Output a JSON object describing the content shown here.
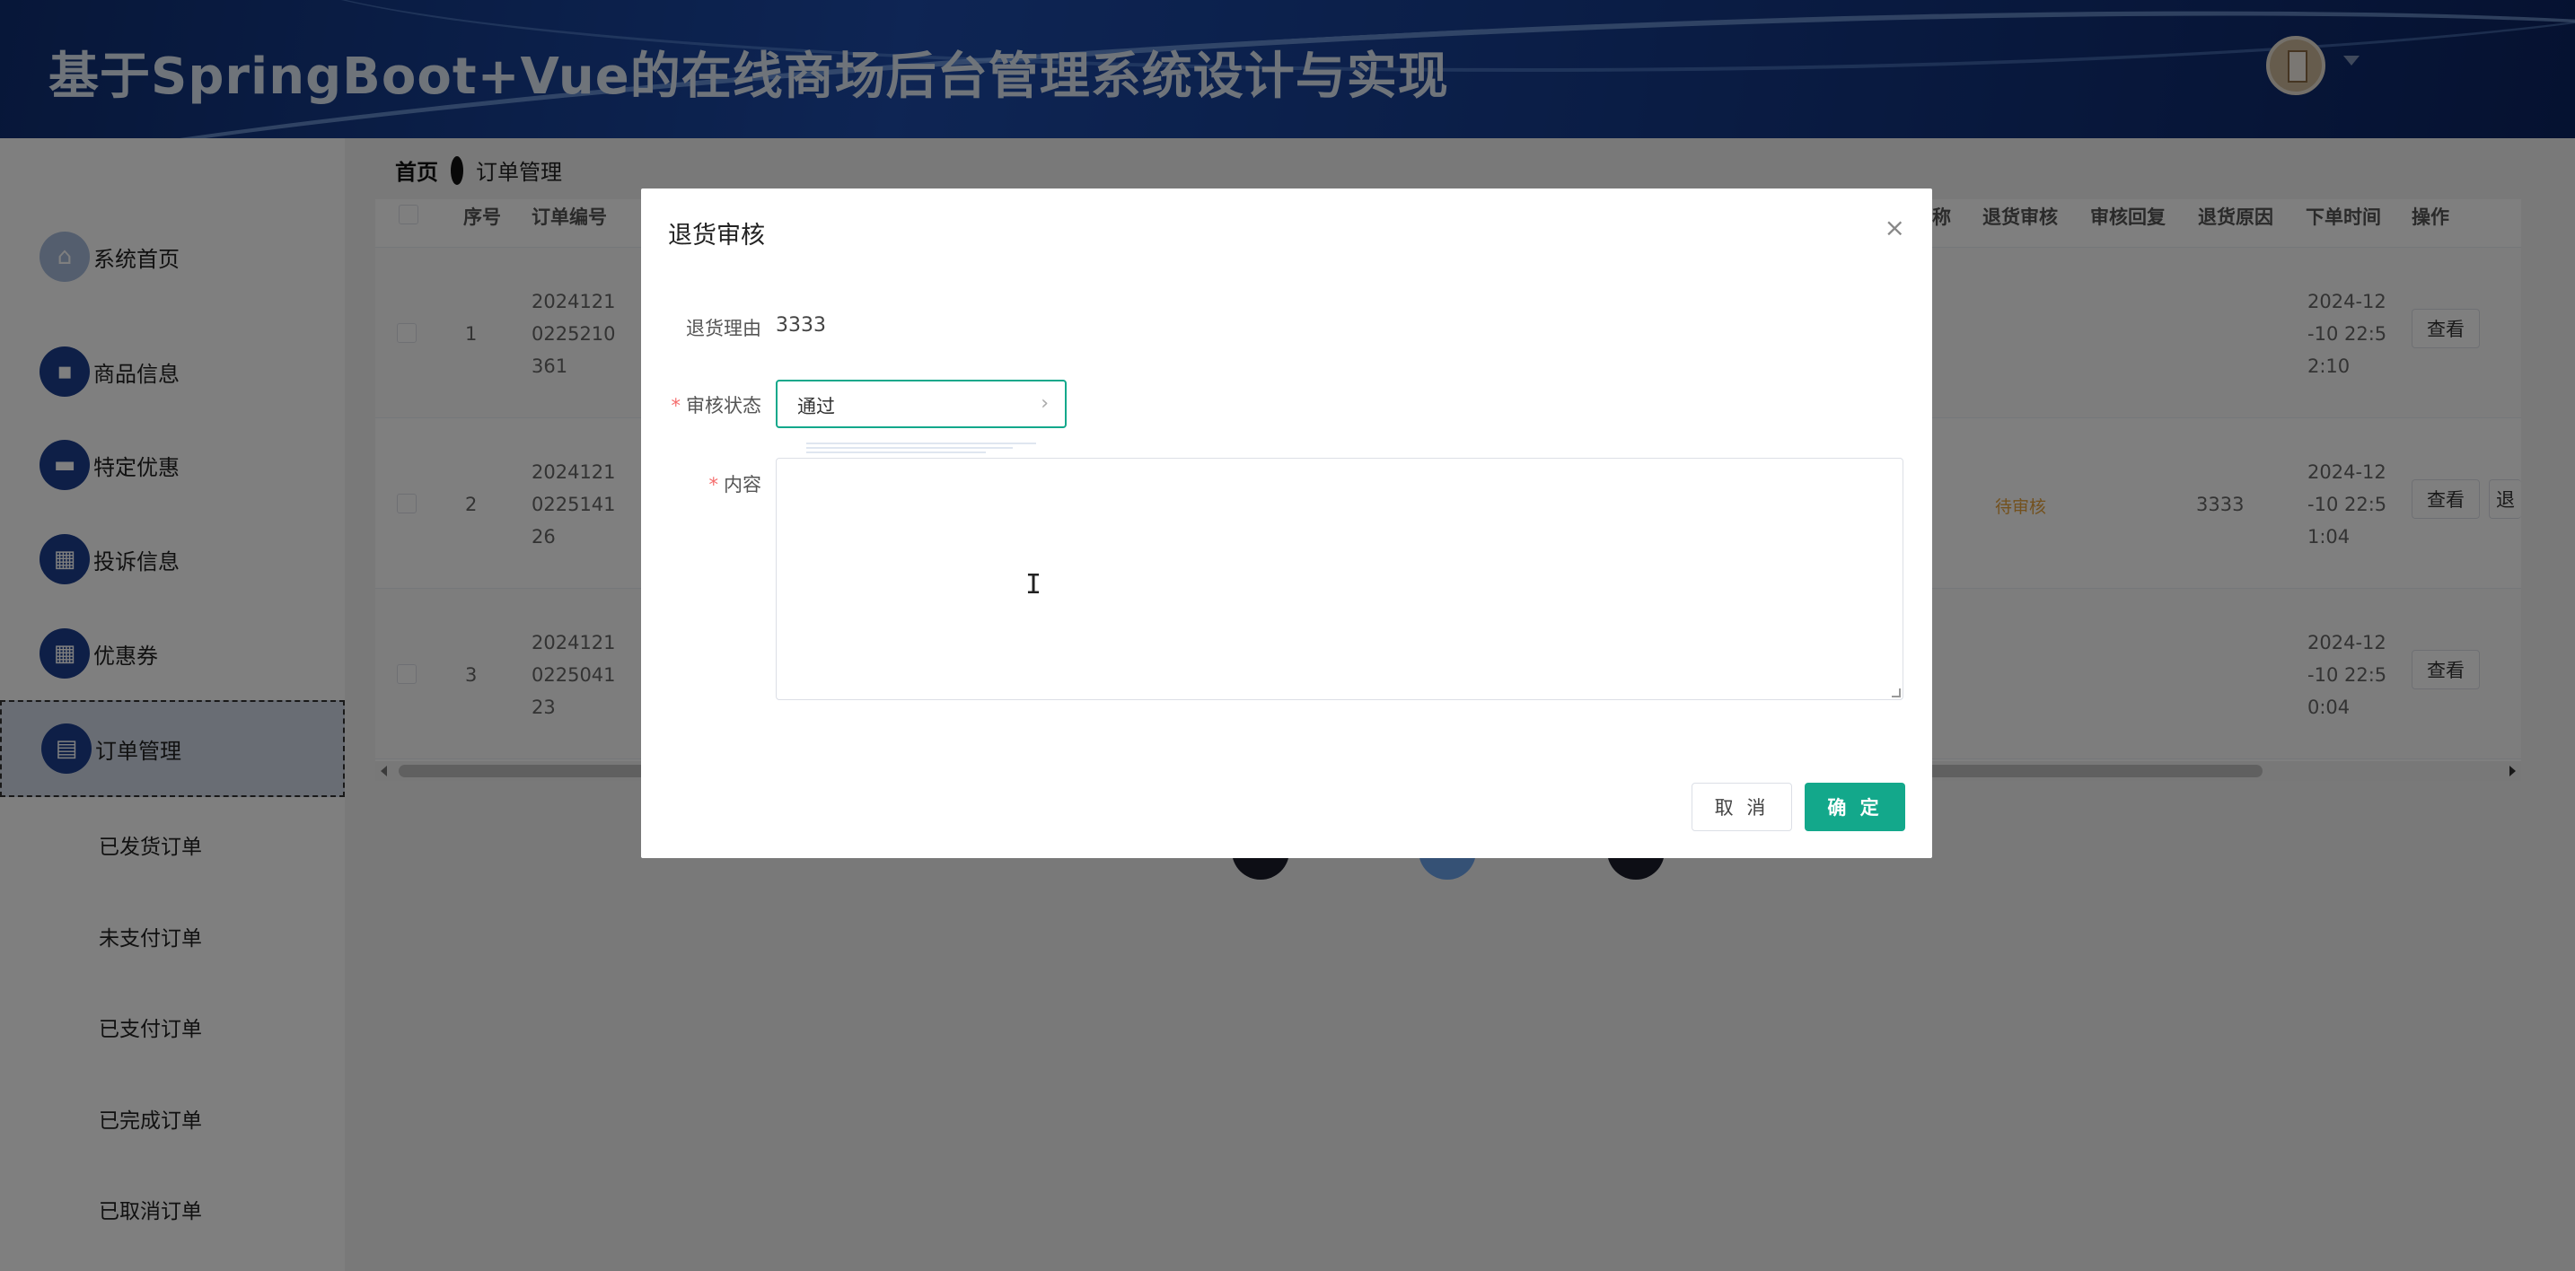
{
  "header": {
    "title": "基于SpringBoot+Vue的在线商场后台管理系统设计与实现"
  },
  "sidebar": {
    "items": [
      {
        "label": "系统首页",
        "icon": "home-icon"
      },
      {
        "label": "商品信息",
        "icon": "chat-icon"
      },
      {
        "label": "特定优惠",
        "icon": "briefcase-icon"
      },
      {
        "label": "投诉信息",
        "icon": "grid-icon"
      },
      {
        "label": "优惠券",
        "icon": "grid-icon"
      },
      {
        "label": "订单管理",
        "icon": "clipboard-icon"
      }
    ],
    "sub_items": [
      "已发货订单",
      "未支付订单",
      "已支付订单",
      "已完成订单",
      "已取消订单"
    ]
  },
  "breadcrumb": {
    "home": "首页",
    "current": "订单管理"
  },
  "table": {
    "headers": {
      "index": "序号",
      "order_no": "订单编号",
      "name_suffix": "称",
      "return_review": "退货审核",
      "review_reply": "审核回复",
      "return_reason": "退货原因",
      "order_time": "下单时间",
      "action": "操作"
    },
    "rows": [
      {
        "index": "1",
        "order_no": [
          "2024121",
          "0225210",
          "361"
        ],
        "review": "",
        "reason": "",
        "time": [
          "2024-12",
          "-10 22:5",
          "2:10"
        ],
        "view": "查看"
      },
      {
        "index": "2",
        "order_no": [
          "2024121",
          "0225141",
          "26"
        ],
        "review": "待审核",
        "reason": "3333",
        "time": [
          "2024-12",
          "-10 22:5",
          "1:04"
        ],
        "view": "查看",
        "extra": "退"
      },
      {
        "index": "3",
        "order_no": [
          "2024121",
          "0225041",
          "23"
        ],
        "review": "",
        "reason": "",
        "time": [
          "2024-12",
          "-10 22:5",
          "0:04"
        ],
        "view": "查看"
      }
    ]
  },
  "dialog": {
    "title": "退货审核",
    "reason_label": "退货理由",
    "reason_value": "3333",
    "status_label": "审核状态",
    "status_value": "通过",
    "content_label": "内容",
    "content_value": "",
    "cancel_label": "取 消",
    "ok_label": "确 定"
  },
  "colors": {
    "primary": "#13a88b",
    "header_bg": "#1c4aa8",
    "required": "#f56c6c",
    "pending_tag": "#e6a23c"
  }
}
